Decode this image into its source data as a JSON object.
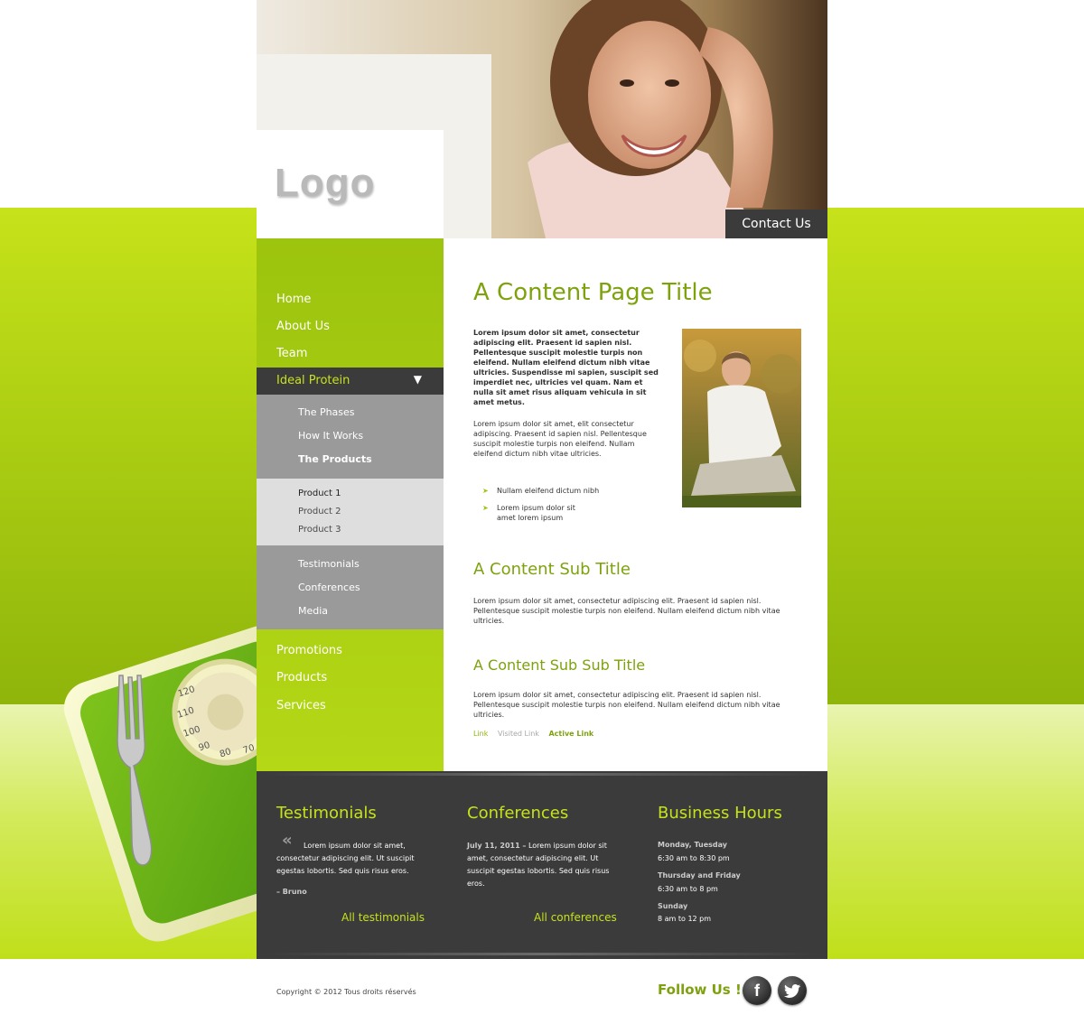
{
  "header": {
    "logo": "Logo",
    "contact": "Contact Us"
  },
  "nav": {
    "items_top": [
      "Home",
      "About Us",
      "Team"
    ],
    "active": "Ideal Protein",
    "sub": [
      "The Phases",
      "How It Works",
      "The Products"
    ],
    "products": [
      "Product 1",
      "Product 2",
      "Product 3"
    ],
    "sub2": [
      "Testimonials",
      "Conferences",
      "Media"
    ],
    "items_bottom": [
      "Promotions",
      "Products",
      "Services"
    ]
  },
  "content": {
    "title": "A Content Page Title",
    "intro_bold": "Lorem ipsum dolor sit amet, consectetur adipiscing elit. Praesent id sapien nisl. Pellentesque suscipit molestie turpis non eleifend. Nullam eleifend dictum nibh vitae ultricies. Suspendisse mi sapien, suscipit sed imperdiet nec, ultricies vel quam. Nam et nulla sit amet risus aliquam vehicula in sit amet metus.",
    "intro": "Lorem ipsum dolor sit amet, elit consectetur adipiscing. Praesent id sapien nisl. Pellentesque suscipit molestie turpis non eleifend. Nullam eleifend dictum nibh vitae ultricies.",
    "bullets": [
      "Nullam eleifend dictum nibh",
      "Lorem ipsum dolor sit amet lorem ipsum"
    ],
    "sub_title": "A Content Sub Title",
    "para1": "Lorem ipsum dolor sit amet, consectetur adipiscing elit. Praesent id sapien nisl. Pellentesque suscipit molestie turpis non eleifend. Nullam eleifend dictum nibh vitae ultricies.",
    "sub_sub_title": "A Content Sub Sub Title",
    "para2": "Lorem ipsum dolor sit amet, consectetur adipiscing elit. Praesent id sapien nisl. Pellentesque suscipit molestie turpis non eleifend. Nullam eleifend dictum nibh vitae ultricies.",
    "links": {
      "link": "Link",
      "visited": "Visited Link",
      "active": "Active Link"
    }
  },
  "footer": {
    "testimonials": {
      "title": "Testimonials",
      "quote_mark": "«",
      "text": "Lorem ipsum dolor sit amet, consectetur adipiscing elit. Ut suscipit egestas lobortis. Sed quis risus eros.",
      "author": "– Bruno",
      "link": "All testimonials"
    },
    "conferences": {
      "title": "Conferences",
      "date": "July 11, 2011 –",
      "text": "Lorem ipsum dolor sit amet, consectetur adipiscing elit. Ut suscipit egestas lobortis. Sed quis risus eros.",
      "link": "All conferences"
    },
    "hours": {
      "title": "Business Hours",
      "rows": [
        {
          "day": "Monday, Tuesday",
          "time": "6:30 am to 8:30 pm"
        },
        {
          "day": "Thursday and Friday",
          "time": "6:30 am to 8 pm"
        },
        {
          "day": "Sunday",
          "time": "8 am to 12 pm"
        }
      ]
    }
  },
  "bottom": {
    "copyright": "Copyright © 2012 Tous droits réservés",
    "follow": "Follow Us !",
    "social": [
      {
        "icon": "facebook-icon",
        "glyph": "f"
      },
      {
        "icon": "twitter-icon",
        "glyph": "t"
      }
    ]
  },
  "scale": {
    "dial_labels": [
      "120",
      "110",
      "100",
      "90",
      "80",
      "70"
    ]
  },
  "colors": {
    "accent": "#7ea20d",
    "lime": "#c6e21b",
    "dark": "#3b3b3b"
  }
}
